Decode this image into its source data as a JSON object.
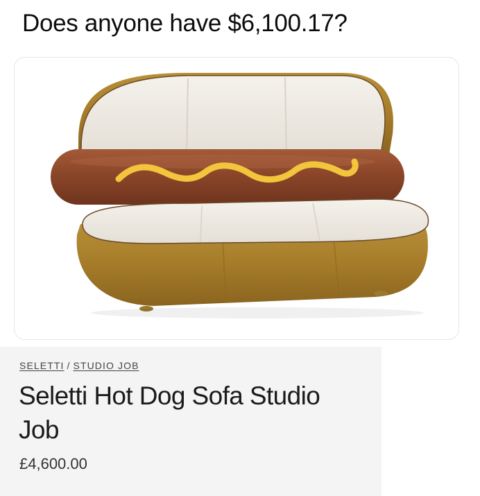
{
  "post": {
    "title": "Does anyone have $6,100.17?"
  },
  "image": {
    "icon": "hot-dog-sofa-image"
  },
  "product": {
    "breadcrumb": [
      {
        "label": "SELETTI"
      },
      {
        "label": "STUDIO JOB"
      }
    ],
    "breadcrumb_separator": "/",
    "name": "Seletti Hot Dog Sofa Studio Job",
    "price": "£4,600.00"
  },
  "colors": {
    "bun": "#a98330",
    "cushion": "#eeeae3",
    "sausage": "#8e4a2e",
    "mustard": "#f2c53d",
    "panel": "#f4f4f4"
  }
}
